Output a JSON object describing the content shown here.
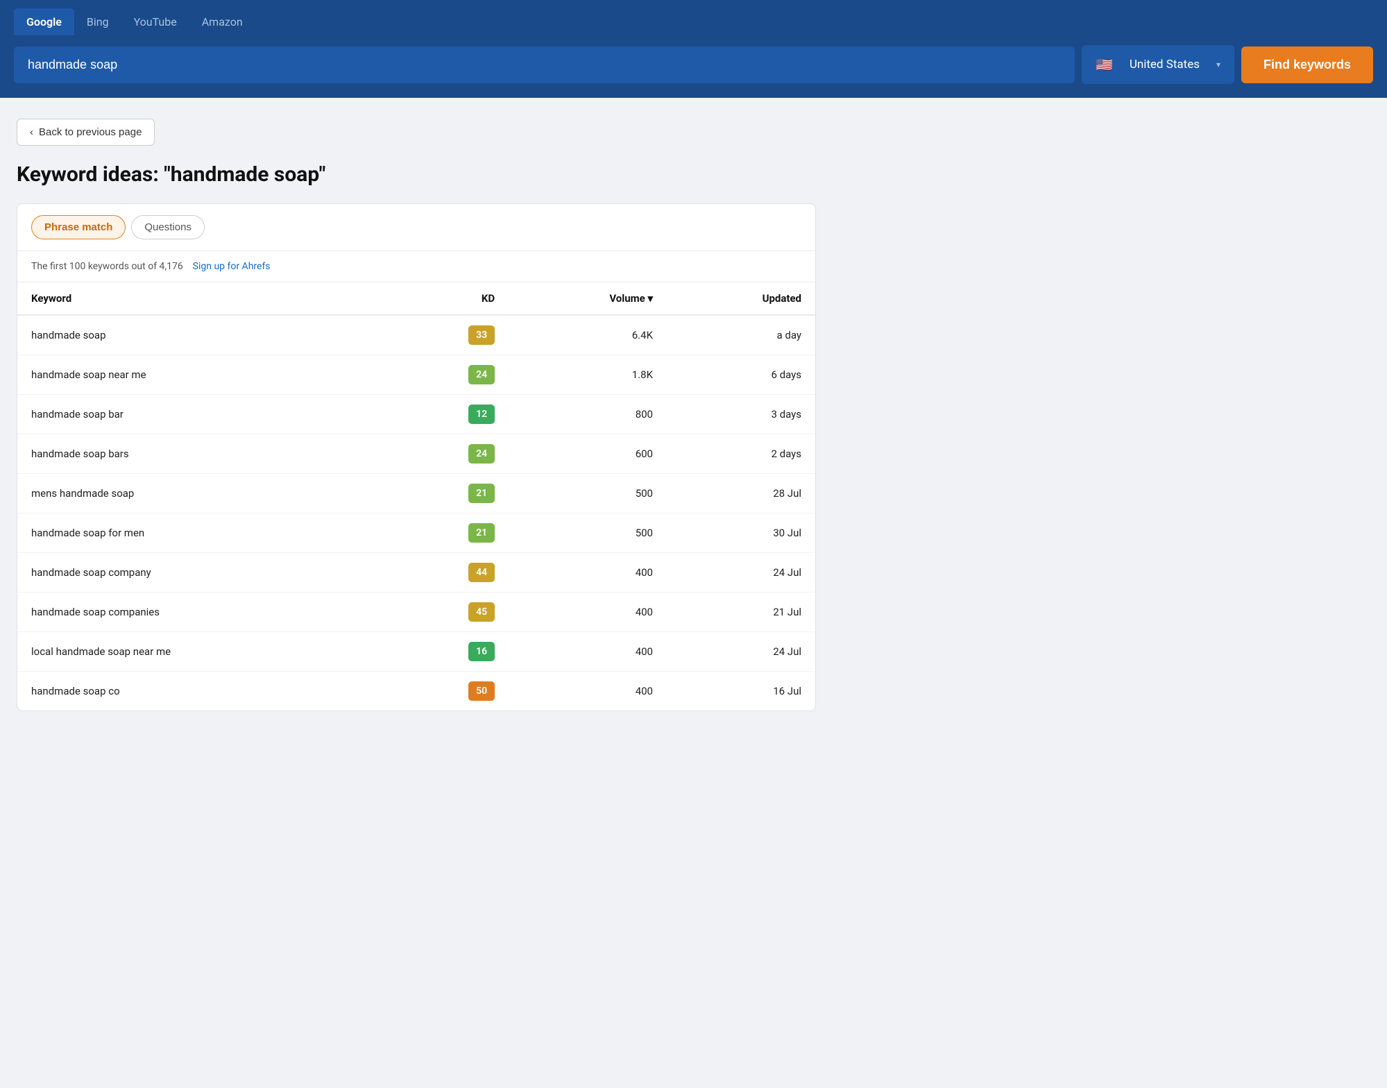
{
  "header": {
    "nav_tabs": [
      {
        "label": "Google",
        "active": true
      },
      {
        "label": "Bing",
        "active": false
      },
      {
        "label": "YouTube",
        "active": false
      },
      {
        "label": "Amazon",
        "active": false
      }
    ],
    "search_value": "handmade soap",
    "search_placeholder": "handmade soap",
    "country_label": "United States",
    "country_flag": "🇺🇸",
    "find_btn_label": "Find keywords"
  },
  "back_btn": "Back to previous page",
  "page_title": "Keyword ideas: \"handmade soap\"",
  "tabs": [
    {
      "label": "Phrase match",
      "active": true
    },
    {
      "label": "Questions",
      "active": false
    }
  ],
  "info_text": "The first 100 keywords out of 4,176",
  "signup_link": "Sign up for Ahrefs",
  "table": {
    "columns": [
      {
        "label": "Keyword",
        "align": "left"
      },
      {
        "label": "KD",
        "align": "right"
      },
      {
        "label": "Volume ▾",
        "align": "right",
        "sort": true
      },
      {
        "label": "Updated",
        "align": "right"
      }
    ],
    "rows": [
      {
        "keyword": "handmade soap",
        "kd": 33,
        "kd_color": "kd-yellow",
        "volume": "6.4K",
        "updated": "a day"
      },
      {
        "keyword": "handmade soap near me",
        "kd": 24,
        "kd_color": "kd-light-green",
        "volume": "1.8K",
        "updated": "6 days"
      },
      {
        "keyword": "handmade soap bar",
        "kd": 12,
        "kd_color": "kd-green",
        "volume": "800",
        "updated": "3 days"
      },
      {
        "keyword": "handmade soap bars",
        "kd": 24,
        "kd_color": "kd-light-green",
        "volume": "600",
        "updated": "2 days"
      },
      {
        "keyword": "mens handmade soap",
        "kd": 21,
        "kd_color": "kd-light-green",
        "volume": "500",
        "updated": "28 Jul"
      },
      {
        "keyword": "handmade soap for men",
        "kd": 21,
        "kd_color": "kd-light-green",
        "volume": "500",
        "updated": "30 Jul"
      },
      {
        "keyword": "handmade soap company",
        "kd": 44,
        "kd_color": "kd-yellow",
        "volume": "400",
        "updated": "24 Jul"
      },
      {
        "keyword": "handmade soap companies",
        "kd": 45,
        "kd_color": "kd-yellow",
        "volume": "400",
        "updated": "21 Jul"
      },
      {
        "keyword": "local handmade soap near me",
        "kd": 16,
        "kd_color": "kd-green",
        "volume": "400",
        "updated": "24 Jul"
      },
      {
        "keyword": "handmade soap co",
        "kd": 50,
        "kd_color": "kd-orange",
        "volume": "400",
        "updated": "16 Jul"
      }
    ]
  }
}
